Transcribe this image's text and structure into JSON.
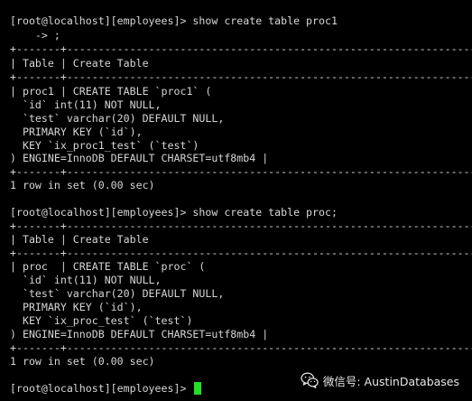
{
  "terminal": {
    "lines": [
      "[root@localhost][employees]> show create table proc1",
      "    -> ;",
      "+-------+---------------------------------------------------------------------------------",
      "| Table | Create Table",
      "+-------+---------------------------------------------------------------------------------",
      "| proc1 | CREATE TABLE `proc1` (",
      "  `id` int(11) NOT NULL,",
      "  `test` varchar(20) DEFAULT NULL,",
      "  PRIMARY KEY (`id`),",
      "  KEY `ix_proc1_test` (`test`)",
      ") ENGINE=InnoDB DEFAULT CHARSET=utf8mb4 |",
      "+-------+---------------------------------------------------------------------------------",
      "1 row in set (0.00 sec)",
      "",
      "[root@localhost][employees]> show create table proc;",
      "+-------+---------------------------------------------------------------------------------",
      "| Table | Create Table",
      "+-------+---------------------------------------------------------------------------------",
      "| proc  | CREATE TABLE `proc` (",
      "  `id` int(11) NOT NULL,",
      "  `test` varchar(20) DEFAULT NULL,",
      "  PRIMARY KEY (`id`),",
      "  KEY `ix_proc_test` (`test`)",
      ") ENGINE=InnoDB DEFAULT CHARSET=utf8mb4 |",
      "+-------+---------------------------------------------------------------------------------",
      "1 row in set (0.00 sec)",
      "",
      "[root@localhost][employees]> "
    ],
    "cursor_color": "#22e022",
    "text_color": "#d6d6d6",
    "background": "#000000"
  },
  "watermark": {
    "text": "微信号: AustinDatabases",
    "icon": "wechat-icon"
  }
}
